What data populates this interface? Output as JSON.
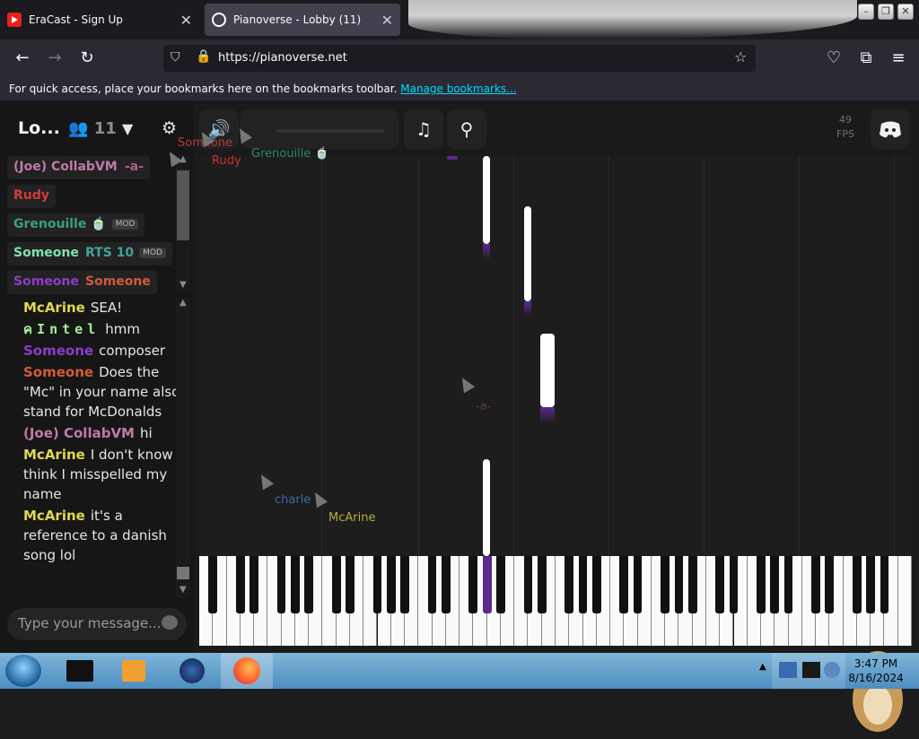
{
  "browser": {
    "tabs": [
      {
        "title": "EraCast - Sign Up",
        "active": false
      },
      {
        "title": "Pianoverse - Lobby (11)",
        "active": true
      }
    ],
    "url": "https://pianoverse.net",
    "bookmarks_hint": "For quick access, place your bookmarks here on the bookmarks toolbar.",
    "bookmarks_link": "Manage bookmarks..."
  },
  "lobby": {
    "name": "Lo...",
    "user_count": "11",
    "users": [
      {
        "name": "(Joe) CollabVM",
        "color": "#c07aa8"
      },
      {
        "name": "-a-",
        "color": "#b65a8a"
      },
      {
        "name": "Rudy",
        "color": "#d33b3b"
      },
      {
        "name": "Grenouille 🍵",
        "color": "#3aa07a",
        "mod": "MOD"
      },
      {
        "name": "Someone",
        "color": "#7fe3b0"
      },
      {
        "name": "RTS 10",
        "color": "#3fa39a",
        "mod": "MOD"
      },
      {
        "name": "Someone",
        "color": "#8e3cc8"
      },
      {
        "name": "Someone",
        "color": "#d35a3a"
      }
    ]
  },
  "chat": {
    "messages": [
      {
        "user": "McArine",
        "color": "#e0d850",
        "text": "SEA!"
      },
      {
        "user": "คIntel",
        "color": "#a6ef9a",
        "text": "hmm"
      },
      {
        "user": "Someone",
        "color": "#8e3cc8",
        "text": "composer"
      },
      {
        "user": "Someone",
        "color": "#d35a3a",
        "text": "Does the \"Mc\" in your name also stand for McDonalds"
      },
      {
        "user": "(Joe) CollabVM",
        "color": "#c07aa8",
        "text": "hi"
      },
      {
        "user": "McArine",
        "color": "#e0d850",
        "text": "I don't know I think I misspelled my name"
      },
      {
        "user": "McArine",
        "color": "#e0d850",
        "text": "it's a reference to a danish song lol"
      }
    ],
    "input_placeholder": "Type your message..."
  },
  "toolbar": {
    "fps_value": "49",
    "fps_label": "FPS"
  },
  "cursors": [
    {
      "name": "Someone",
      "color": "#b83a3a"
    },
    {
      "name": "Rudy",
      "color": "#c03030"
    },
    {
      "name": "Grenouille 🍵",
      "color": "#2e8a5e"
    },
    {
      "name": "-a-",
      "color": "#5a3a4a"
    },
    {
      "name": "charle",
      "color": "#3a6aa0"
    },
    {
      "name": "McArine",
      "color": "#b7ad3c"
    },
    {
      "name": "Someone",
      "color": "#3a5aa0"
    }
  ],
  "taskbar": {
    "time": "3:47 PM",
    "date": "8/16/2024"
  },
  "colors": {
    "accent": "#5b2a8a",
    "link": "#00ddff"
  }
}
